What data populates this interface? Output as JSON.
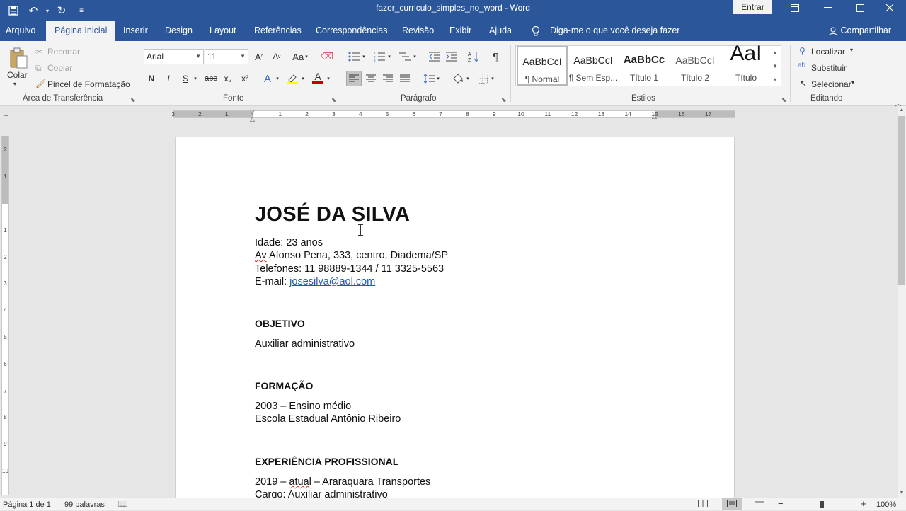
{
  "window": {
    "title": "fazer_curriculo_simples_no_word  -  Word",
    "signin_label": "Entrar"
  },
  "tabs": [
    {
      "label": "Arquivo"
    },
    {
      "label": "Página Inicial",
      "active": true
    },
    {
      "label": "Inserir"
    },
    {
      "label": "Design"
    },
    {
      "label": "Layout"
    },
    {
      "label": "Referências"
    },
    {
      "label": "Correspondências"
    },
    {
      "label": "Revisão"
    },
    {
      "label": "Exibir"
    },
    {
      "label": "Ajuda"
    }
  ],
  "tell_me": "Diga-me o que você deseja fazer",
  "share_label": "Compartilhar",
  "clipboard": {
    "paste": "Colar",
    "cut": "Recortar",
    "copy": "Copiar",
    "format_painter": "Pincel de Formatação",
    "group": "Área de Transferência"
  },
  "font": {
    "name": "Arial",
    "size": "11",
    "group": "Fonte",
    "grow": "A",
    "shrink": "A",
    "case": "Aa",
    "bold": "N",
    "italic": "I",
    "underline": "S",
    "strike": "abc",
    "subscript": "x₂",
    "superscript": "x²",
    "effects": "A",
    "color": "A"
  },
  "paragraph": {
    "group": "Parágrafo"
  },
  "styles": {
    "group": "Estilos",
    "items": [
      {
        "preview": "AaBbCcI",
        "name": "¶ Normal"
      },
      {
        "preview": "AaBbCcI",
        "name": "¶ Sem Esp..."
      },
      {
        "preview": "AaBbCc",
        "name": "Título 1"
      },
      {
        "preview": "AaBbCcI",
        "name": "Título 2"
      },
      {
        "preview": "AaI",
        "name": "Título"
      }
    ]
  },
  "editing": {
    "find": "Localizar",
    "replace": "Substituir",
    "select": "Selecionar",
    "group": "Editando"
  },
  "ruler": {
    "h_labels": [
      "3",
      "2",
      "1",
      "1",
      "2",
      "3",
      "4",
      "5",
      "6",
      "7",
      "8",
      "9",
      "10",
      "11",
      "12",
      "13",
      "14",
      "15",
      "16",
      "17"
    ],
    "v_labels": [
      "2",
      "1",
      "1",
      "2",
      "3",
      "4",
      "5",
      "6",
      "7",
      "8",
      "9",
      "10"
    ]
  },
  "document": {
    "name": "JOSÉ DA SILVA",
    "age": "Idade: 23 anos",
    "address_abbr": "Av",
    "address_rest": " Afonso Pena, 333, centro, Diadema/SP",
    "phones": "Telefones: 11 98889-1344 / 11 3325-5563",
    "email_label": "E-mail: ",
    "email": "josesilva@aol.com",
    "sections": [
      {
        "heading": "OBJETIVO",
        "lines": [
          "Auxiliar administrativo"
        ]
      },
      {
        "heading": "FORMAÇÃO",
        "lines": [
          "2003 – Ensino médio",
          "Escola Estadual Antônio Ribeiro"
        ]
      },
      {
        "heading": "EXPERIÊNCIA PROFISSIONAL"
      }
    ],
    "exp_year": "2019 – ",
    "exp_atual": "atual",
    "exp_company": " – Araraquara Transportes",
    "exp_role": "Cargo: Auxiliar administrativo"
  },
  "status": {
    "page": "Página 1 de 1",
    "words": "99 palavras",
    "zoom": "100%",
    "zoom_minus": "−",
    "zoom_plus": "+"
  }
}
